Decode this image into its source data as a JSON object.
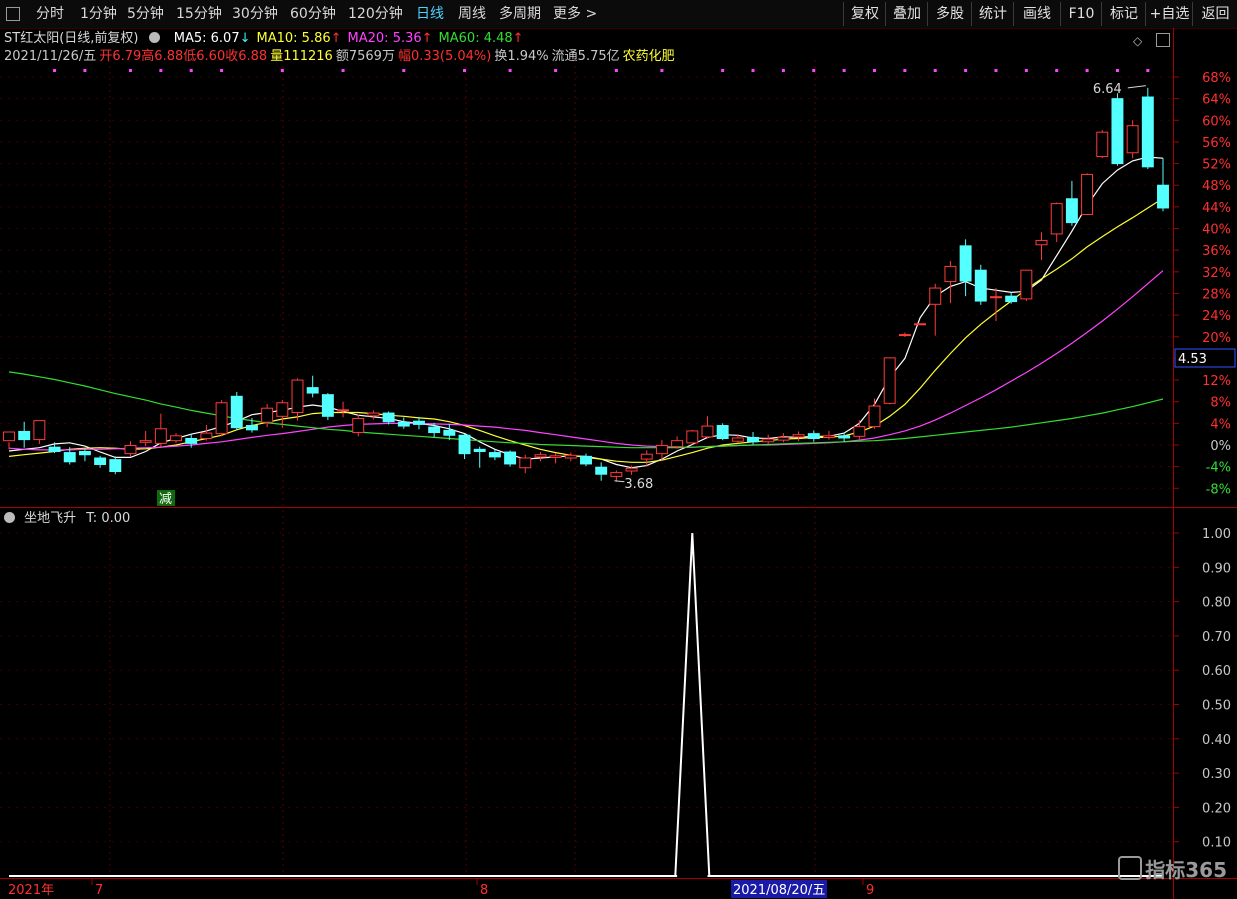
{
  "toolbar": {
    "left_tabs": [
      "分时",
      "1分钟",
      "5分钟",
      "15分钟",
      "30分钟",
      "60分钟",
      "120分钟",
      "日线",
      "周线",
      "多周期",
      "更多 >"
    ],
    "active_tab": "日线",
    "right_buttons": [
      "复权",
      "叠加",
      "多股",
      "统计",
      "画线",
      "F10",
      "标记",
      "+自选",
      "返回"
    ]
  },
  "header": {
    "stock_title": "ST红太阳(日线,前复权)",
    "ma": [
      {
        "label": "MA5: 6.07",
        "arrow": "↓",
        "color": "#ffffff",
        "arrow_color": "#3ff3ff"
      },
      {
        "label": "MA10: 5.86",
        "arrow": "↑",
        "color": "#ffff33",
        "arrow_color": "#ff3030"
      },
      {
        "label": "MA20: 5.36",
        "arrow": "↑",
        "color": "#ff44ff",
        "arrow_color": "#ff3030"
      },
      {
        "label": "MA60: 4.48",
        "arrow": "↑",
        "color": "#33dd33",
        "arrow_color": "#ff3030"
      }
    ],
    "quote": [
      {
        "t": "2021/11/26/五",
        "c": "#c8c8c8"
      },
      {
        "t": "开",
        "c": "#ff3030"
      },
      {
        "t": "6.79",
        "c": "#ff3030"
      },
      {
        "t": "高",
        "c": "#ff3030"
      },
      {
        "t": "6.88",
        "c": "#ff3030"
      },
      {
        "t": "低",
        "c": "#ff3030"
      },
      {
        "t": "6.60",
        "c": "#ff3030"
      },
      {
        "t": "收",
        "c": "#ff3030"
      },
      {
        "t": "6.88",
        "c": "#ff3030"
      },
      {
        "t": "量",
        "c": "#ffff33"
      },
      {
        "t": "111216",
        "c": "#ffff33"
      },
      {
        "t": "额",
        "c": "#c8c8c8"
      },
      {
        "t": "7569万",
        "c": "#c8c8c8"
      },
      {
        "t": "幅",
        "c": "#ff3030"
      },
      {
        "t": "0.33(5.04%)",
        "c": "#ff3030"
      },
      {
        "t": "换1.94%",
        "c": "#c8c8c8"
      },
      {
        "t": "流通5.75亿",
        "c": "#c8c8c8"
      },
      {
        "t": "农药化肥",
        "c": "#ffff33"
      }
    ],
    "indicator_title": "坐地飞升",
    "indicator_value": "T: 0.00",
    "reduce_tag": "减",
    "price_box": "4.53",
    "high_label": "6.64",
    "low_label": "3.68"
  },
  "chart_data": [
    {
      "type": "candlestick",
      "y_axis": "percent",
      "ylim": [
        -10,
        70
      ],
      "y_ticks": [
        "68%",
        "64%",
        "60%",
        "56%",
        "52%",
        "48%",
        "44%",
        "40%",
        "36%",
        "32%",
        "28%",
        "24%",
        "20%",
        "16%",
        "12%",
        "8%",
        "4%",
        "0%",
        "-4%",
        "-8%"
      ],
      "x_labels": [
        "2021年",
        "7",
        "8",
        "2021/08/20/五",
        "9"
      ],
      "candles": [
        [
          0.8,
          2.4,
          -0.8,
          0.5
        ],
        [
          2.5,
          1.0,
          -0.5,
          4.3
        ],
        [
          1.0,
          4.5,
          0.2,
          2.9
        ],
        [
          -0.4,
          -1.2,
          -1.5,
          0.5
        ],
        [
          -1.4,
          -3.1,
          -3.6,
          -0.4
        ],
        [
          -1.2,
          -1.8,
          -3.0,
          -0.7
        ],
        [
          -2.4,
          -3.6,
          -4.2,
          -2.0
        ],
        [
          -2.7,
          -4.9,
          -5.4,
          -2.1
        ],
        [
          -1.6,
          -0.1,
          -2.2,
          0.7
        ],
        [
          0.5,
          0.8,
          -0.2,
          2.6
        ],
        [
          0.3,
          3.0,
          -0.3,
          5.8
        ],
        [
          0.8,
          1.7,
          0.4,
          2.2
        ],
        [
          1.2,
          0.3,
          -0.5,
          2.0
        ],
        [
          1.2,
          2.2,
          0.8,
          3.7
        ],
        [
          2.1,
          7.8,
          1.6,
          8.3
        ],
        [
          9.0,
          3.2,
          2.8,
          9.8
        ],
        [
          3.6,
          2.8,
          2.3,
          5.0
        ],
        [
          4.2,
          6.8,
          3.3,
          7.6
        ],
        [
          5.3,
          7.8,
          3.2,
          8.3
        ],
        [
          6.0,
          12.0,
          4.5,
          12.3
        ],
        [
          10.6,
          9.6,
          8.8,
          12.8
        ],
        [
          9.3,
          5.3,
          4.6,
          9.6
        ],
        [
          6.4,
          6.5,
          5.1,
          8.0
        ],
        [
          2.3,
          4.9,
          1.6,
          5.6
        ],
        [
          5.4,
          5.9,
          4.7,
          6.4
        ],
        [
          5.9,
          4.3,
          3.8,
          6.2
        ],
        [
          4.2,
          3.5,
          3.0,
          5.1
        ],
        [
          4.4,
          3.8,
          2.9,
          5.2
        ],
        [
          3.3,
          2.3,
          1.4,
          4.1
        ],
        [
          2.7,
          1.8,
          0.9,
          3.9
        ],
        [
          1.8,
          -1.6,
          -2.6,
          2.0
        ],
        [
          -0.8,
          -1.2,
          -4.2,
          -0.3
        ],
        [
          -1.4,
          -2.2,
          -2.8,
          -0.8
        ],
        [
          -1.3,
          -3.5,
          -4.0,
          -1.0
        ],
        [
          -4.2,
          -2.4,
          -5.2,
          -1.8
        ],
        [
          -2.2,
          -1.8,
          -3.0,
          -1.3
        ],
        [
          -2.3,
          -2.0,
          -3.4,
          -1.5
        ],
        [
          -2.4,
          -1.9,
          -3.0,
          -1.4
        ],
        [
          -2.1,
          -3.5,
          -3.9,
          -1.6
        ],
        [
          -4.1,
          -5.4,
          -6.6,
          -3.2
        ],
        [
          -5.8,
          -5.1,
          -6.8,
          -4.7
        ],
        [
          -4.8,
          -4.3,
          -5.5,
          -3.8
        ],
        [
          -2.6,
          -1.7,
          -4.0,
          -1.0
        ],
        [
          -1.6,
          -0.1,
          -3.0,
          0.9
        ],
        [
          -0.3,
          0.8,
          -0.7,
          1.6
        ],
        [
          0.4,
          2.6,
          0.1,
          2.8
        ],
        [
          1.5,
          3.5,
          1.2,
          5.3
        ],
        [
          3.6,
          1.2,
          0.9,
          4.0
        ],
        [
          0.7,
          1.3,
          0.3,
          2.0
        ],
        [
          1.4,
          0.6,
          0.1,
          2.4
        ],
        [
          0.6,
          1.1,
          0.2,
          1.9
        ],
        [
          0.9,
          1.4,
          0.5,
          2.2
        ],
        [
          1.5,
          1.9,
          0.7,
          2.5
        ],
        [
          2.1,
          1.2,
          0.6,
          2.7
        ],
        [
          1.4,
          1.7,
          1.0,
          2.6
        ],
        [
          1.7,
          1.3,
          0.6,
          2.3
        ],
        [
          1.6,
          3.4,
          1.0,
          4.6
        ],
        [
          3.4,
          7.2,
          3.0,
          8.6
        ],
        [
          7.7,
          16.1,
          7.5,
          16.2
        ],
        [
          20.4,
          20.4,
          20.0,
          20.8
        ],
        [
          22.4,
          22.4,
          22.4,
          22.4
        ],
        [
          26.0,
          29.0,
          20.2,
          29.8
        ],
        [
          30.2,
          33.0,
          26.2,
          34.0
        ],
        [
          36.8,
          30.3,
          27.5,
          38.0
        ],
        [
          32.3,
          26.6,
          25.9,
          33.3
        ],
        [
          27.3,
          27.4,
          22.9,
          29.0
        ],
        [
          27.5,
          26.5,
          26.1,
          28.2
        ],
        [
          27.0,
          32.3,
          26.6,
          32.4
        ],
        [
          37.0,
          37.8,
          34.2,
          39.3
        ],
        [
          39.0,
          44.6,
          37.5,
          44.8
        ],
        [
          45.5,
          41.1,
          40.5,
          48.8
        ],
        [
          42.6,
          50.0,
          42.5,
          50.2
        ],
        [
          53.3,
          57.8,
          53.0,
          58.2
        ],
        [
          64.0,
          52.0,
          51.6,
          65.0
        ],
        [
          54.0,
          59.0,
          53.0,
          60.0
        ],
        [
          64.3,
          51.4,
          51.0,
          66.0
        ],
        [
          48.0,
          43.8,
          43.2,
          53.0
        ]
      ],
      "series": [
        {
          "name": "MA5",
          "color": "#ffffff",
          "values": [
            -1.1,
            -0.8,
            -0.5,
            0.2,
            0.4,
            -0.2,
            -1.3,
            -2.3,
            -2.3,
            -1.2,
            0.4,
            1.2,
            2.0,
            2.6,
            3.4,
            4.4,
            5.6,
            6.0,
            6.4,
            7.0,
            7.4,
            7.0,
            6.2,
            5.5,
            5.2,
            4.9,
            4.3,
            4.0,
            3.6,
            3.0,
            2.1,
            0.6,
            -0.8,
            -1.8,
            -2.6,
            -2.4,
            -2.2,
            -2.0,
            -2.1,
            -2.6,
            -3.6,
            -4.2,
            -3.8,
            -2.6,
            -1.1,
            0.1,
            1.4,
            1.9,
            1.8,
            1.3,
            1.2,
            1.5,
            1.4,
            1.6,
            1.6,
            2.2,
            4.0,
            7.5,
            12.5,
            16.0,
            23.5,
            27.5,
            29.3,
            30.2,
            29.0,
            28.6,
            28.2,
            28.4,
            30.5,
            35.0,
            39.5,
            44.3,
            48.3,
            50.8,
            52.5,
            53.2,
            53.0
          ]
        },
        {
          "name": "MA10",
          "color": "#ffff33",
          "values": [
            -2.1,
            -1.8,
            -1.5,
            -1.2,
            -0.8,
            -0.6,
            -0.5,
            -0.6,
            -0.8,
            -0.7,
            -0.4,
            0.0,
            0.6,
            1.2,
            1.8,
            2.8,
            3.6,
            4.2,
            4.8,
            5.2,
            5.8,
            6.0,
            6.0,
            6.0,
            5.8,
            5.5,
            5.3,
            5.0,
            4.8,
            4.3,
            3.6,
            2.7,
            1.7,
            0.8,
            0.0,
            -0.8,
            -1.4,
            -1.9,
            -2.3,
            -2.6,
            -3.0,
            -3.2,
            -3.2,
            -2.8,
            -2.1,
            -1.4,
            -0.6,
            0.0,
            0.3,
            0.6,
            0.8,
            1.1,
            1.2,
            1.4,
            1.4,
            1.7,
            2.4,
            3.5,
            5.3,
            7.5,
            10.5,
            13.8,
            16.9,
            19.8,
            22.3,
            24.5,
            26.6,
            28.8,
            30.7,
            32.5,
            34.4,
            36.6,
            38.5,
            40.3,
            42.0,
            43.8,
            45.6
          ]
        },
        {
          "name": "MA20",
          "color": "#ff44ff",
          "values": [
            -0.6,
            -0.8,
            -0.9,
            -0.9,
            -0.9,
            -0.8,
            -0.8,
            -0.7,
            -0.6,
            -0.5,
            -0.4,
            -0.2,
            0.0,
            0.3,
            0.6,
            1.0,
            1.4,
            1.8,
            2.1,
            2.5,
            2.9,
            3.3,
            3.6,
            3.8,
            3.9,
            4.0,
            4.0,
            4.0,
            3.9,
            3.8,
            3.7,
            3.5,
            3.3,
            3.0,
            2.7,
            2.3,
            1.9,
            1.5,
            1.1,
            0.7,
            0.3,
            0.0,
            -0.2,
            -0.3,
            -0.4,
            -0.4,
            -0.3,
            -0.2,
            -0.1,
            0.0,
            0.0,
            0.1,
            0.2,
            0.3,
            0.4,
            0.6,
            0.9,
            1.3,
            1.9,
            2.6,
            3.5,
            4.6,
            5.9,
            7.3,
            8.7,
            10.2,
            11.8,
            13.4,
            15.1,
            16.9,
            18.8,
            20.8,
            22.9,
            25.1,
            27.4,
            29.8,
            32.2
          ]
        },
        {
          "name": "MA60",
          "color": "#33dd33",
          "values": [
            13.5,
            13.1,
            12.6,
            12.1,
            11.5,
            10.9,
            10.2,
            9.5,
            8.9,
            8.3,
            7.6,
            7.0,
            6.4,
            5.9,
            5.4,
            4.9,
            4.5,
            4.1,
            3.8,
            3.5,
            3.2,
            2.9,
            2.7,
            2.4,
            2.2,
            2.0,
            1.8,
            1.6,
            1.4,
            1.2,
            1.0,
            0.8,
            0.6,
            0.4,
            0.3,
            0.1,
            0.0,
            -0.1,
            -0.2,
            -0.3,
            -0.4,
            -0.5,
            -0.5,
            -0.5,
            -0.5,
            -0.4,
            -0.3,
            -0.2,
            -0.1,
            0.0,
            0.1,
            0.2,
            0.3,
            0.4,
            0.5,
            0.6,
            0.7,
            0.8,
            1.0,
            1.2,
            1.5,
            1.8,
            2.1,
            2.4,
            2.7,
            3.0,
            3.3,
            3.7,
            4.1,
            4.5,
            4.9,
            5.4,
            5.9,
            6.5,
            7.1,
            7.8,
            8.5
          ]
        }
      ]
    },
    {
      "type": "line",
      "name": "坐地飞升",
      "ylim": [
        0,
        1.0
      ],
      "y_ticks": [
        "1.00",
        "0.90",
        "0.80",
        "0.70",
        "0.60",
        "0.50",
        "0.40",
        "0.30",
        "0.20",
        "0.10"
      ],
      "values": [
        0,
        0,
        0,
        0,
        0,
        0,
        0,
        0,
        0,
        0,
        0,
        0,
        0,
        0,
        0,
        0,
        0,
        0,
        0,
        0,
        0,
        0,
        0,
        0,
        0,
        0,
        0,
        0,
        0,
        0,
        0,
        0,
        0,
        0,
        0,
        0,
        0,
        0,
        0,
        0,
        0,
        0,
        0,
        0,
        0,
        1,
        0,
        0,
        0,
        0,
        0,
        0,
        0,
        0,
        0,
        0,
        0,
        0,
        0,
        0,
        0,
        0,
        0,
        0,
        0,
        0,
        0,
        0,
        0,
        0,
        0,
        0,
        0,
        0,
        0,
        0,
        0
      ],
      "color": "#ffffff"
    }
  ],
  "markers": {
    "color": "#ff44ff",
    "positions": [
      3,
      5,
      8,
      10,
      12,
      14,
      18,
      22,
      26,
      30,
      33,
      36,
      40,
      43,
      47,
      49,
      51,
      53,
      55,
      57,
      59,
      61,
      63,
      65,
      67,
      69,
      71,
      73,
      75
    ]
  },
  "watermark": "指标365"
}
